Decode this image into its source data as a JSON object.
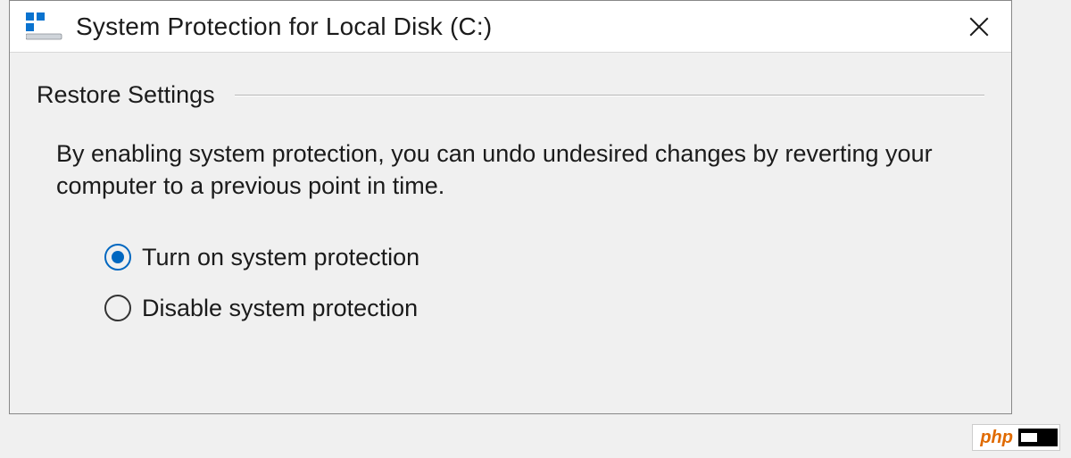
{
  "dialog": {
    "title": "System Protection for Local Disk (C:)"
  },
  "section": {
    "title": "Restore Settings",
    "description": "By enabling system protection, you can undo undesired changes by reverting your computer to a previous point in time."
  },
  "radios": {
    "option1": {
      "label": "Turn on system protection",
      "selected": true
    },
    "option2": {
      "label": "Disable system protection",
      "selected": false
    }
  },
  "watermark": {
    "text": "php"
  }
}
